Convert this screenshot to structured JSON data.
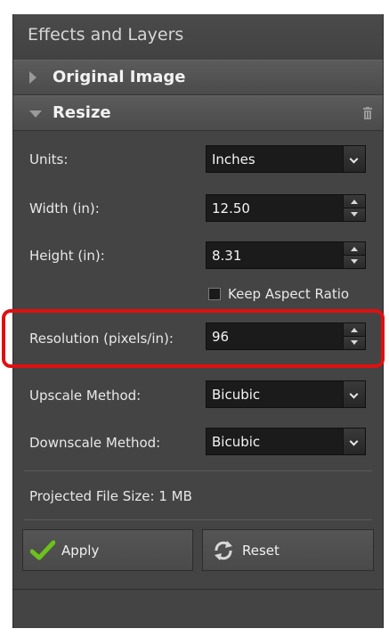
{
  "panel": {
    "title": "Effects and Layers"
  },
  "sections": {
    "original": {
      "label": "Original Image"
    },
    "resize": {
      "label": "Resize"
    }
  },
  "fields": {
    "units": {
      "label": "Units:",
      "value": "Inches"
    },
    "width": {
      "label": "Width (in):",
      "value": "12.50"
    },
    "height": {
      "label": "Height (in):",
      "value": "8.31"
    },
    "keep_aspect": {
      "label": "Keep Aspect Ratio",
      "checked": false
    },
    "resolution": {
      "label": "Resolution (pixels/in):",
      "value": "96"
    },
    "upscale": {
      "label": "Upscale Method:",
      "value": "Bicubic"
    },
    "downscale": {
      "label": "Downscale Method:",
      "value": "Bicubic"
    }
  },
  "projected": "Projected File Size: 1 MB",
  "buttons": {
    "apply": "Apply",
    "reset": "Reset"
  },
  "colors": {
    "panel_bg": "#444444",
    "highlight": "#e01010",
    "apply_check": "#6cc11c"
  }
}
